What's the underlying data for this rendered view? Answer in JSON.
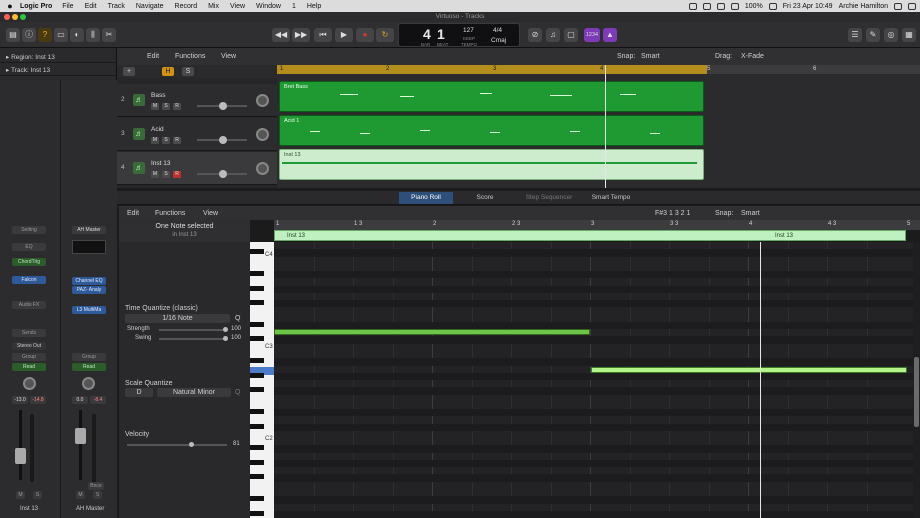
{
  "menubar": {
    "app": "Logic Pro",
    "items": [
      "File",
      "Edit",
      "Track",
      "Navigate",
      "Record",
      "Mix",
      "View",
      "Window",
      "1",
      "Help"
    ],
    "battery": "100%",
    "clock": "Fri 23 Apr 10:49",
    "user": "Archie Hamilton"
  },
  "window": {
    "title": "Virtuoso - Tracks"
  },
  "lcd": {
    "bar": "4",
    "beat": "1",
    "bar_label": "BAR",
    "beat_label": "BEAT",
    "tempo": "127",
    "tempo_label": "KEEP",
    "tempo_sub": "TEMPO",
    "sig": "4/4",
    "key": "Cmaj"
  },
  "toolbar": {
    "count_in": "1234"
  },
  "inspector": {
    "region_label": "Region:",
    "region_name": "Inst 13",
    "track_label": "Track:",
    "track_name": "Inst 13",
    "setting": "Setting",
    "eq": "EQ",
    "chord_trig": "ChordTrig",
    "falcon": "Falcon",
    "audio_fx": "Audio FX",
    "sends": "Sends",
    "stereo_out": "Stereo Out",
    "group": "Group",
    "read": "Read",
    "vol1": "-13.0",
    "pan1": "-14.8",
    "ch1_name": "Inst 13",
    "master_slot": "AH Master",
    "channel_eq": "Channel EQ",
    "paz": "PAZ- Analy",
    "l3": "L3 MultiMa",
    "group2": "Group",
    "read2": "Read",
    "vol2": "0.0",
    "pan2": "-8.4",
    "bnce": "Bnce",
    "ch2_name": "AH Master",
    "mute": "M",
    "solo": "S"
  },
  "tracks_toolbar": {
    "edit": "Edit",
    "functions": "Functions",
    "view": "View",
    "snap_label": "Snap:",
    "snap": "Smart",
    "drag_label": "Drag:",
    "drag": "X-Fade"
  },
  "tracks": [
    {
      "num": "2",
      "name": "Bass",
      "region": "Bret Bass"
    },
    {
      "num": "3",
      "name": "Acid",
      "region": "Acid 1"
    },
    {
      "num": "4",
      "name": "Inst 13",
      "region": "Inst 13"
    }
  ],
  "track_buttons": {
    "m": "M",
    "s": "S",
    "r": "R"
  },
  "ruler_marks": [
    "1",
    "2",
    "3",
    "4",
    "5",
    "6"
  ],
  "lower_tabs": [
    "Piano Roll",
    "Score",
    "Step Sequencer",
    "Smart Tempo"
  ],
  "piano_roll": {
    "edit": "Edit",
    "functions": "Functions",
    "view": "View",
    "position": "F#3  1 3 2 1",
    "snap_label": "Snap:",
    "snap": "Smart",
    "ruler": [
      "1",
      "1 3",
      "2",
      "2 3",
      "3",
      "3 3",
      "4",
      "4 3",
      "5"
    ],
    "region_name": "Inst 13",
    "selection_title": "One Note selected",
    "selection_sub": "in Inst 13",
    "tq_label": "Time Quantize (classic)",
    "tq_value": "1/16 Note",
    "q": "Q",
    "strength_label": "Strength",
    "strength_val": "100",
    "swing_label": "Swing",
    "swing_val": "100",
    "sq_label": "Scale Quantize",
    "sq_root": "D",
    "sq_scale": "Natural Minor",
    "velocity_label": "Velocity",
    "velocity_val": "81",
    "key_labels": [
      "C4",
      "C3",
      "C2"
    ]
  },
  "colors": {
    "accent": "#1f9a33",
    "selected_note": "#b4f28a",
    "note": "#6fc24a",
    "record": "#e0342c",
    "cycle": "#e8a31a"
  }
}
